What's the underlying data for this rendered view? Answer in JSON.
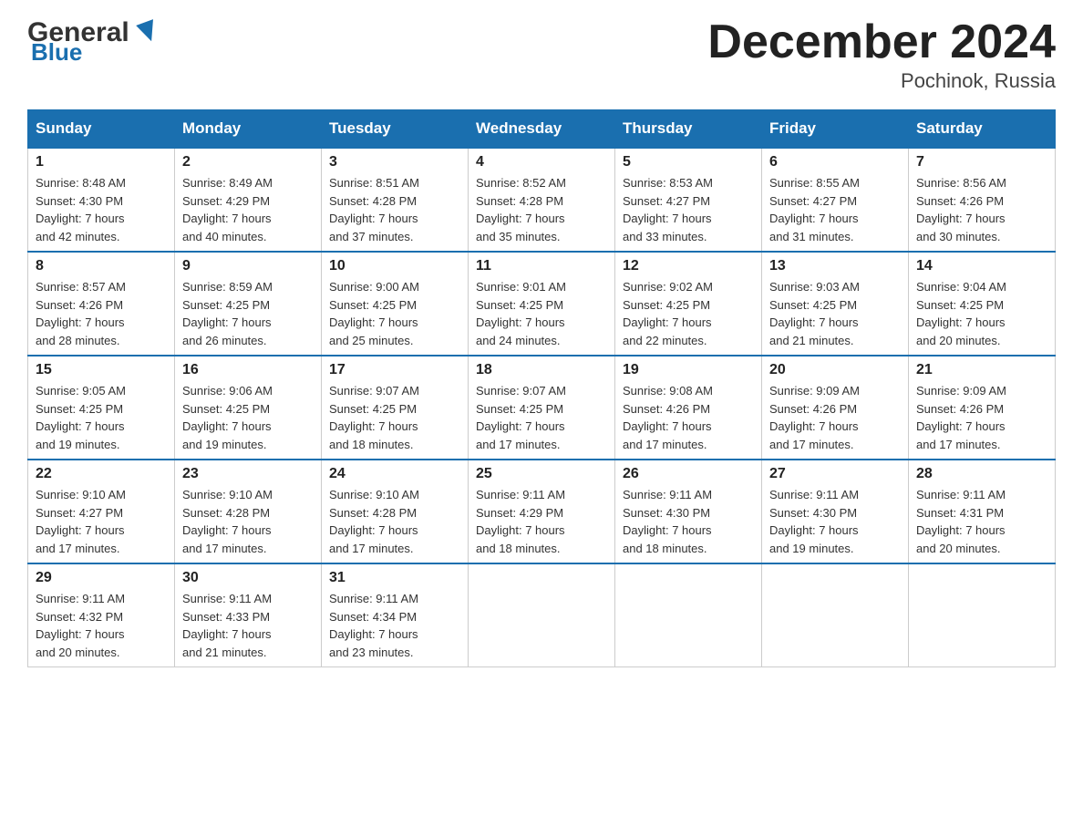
{
  "header": {
    "logo_general": "General",
    "logo_blue": "Blue",
    "title": "December 2024",
    "location": "Pochinok, Russia"
  },
  "days_of_week": [
    "Sunday",
    "Monday",
    "Tuesday",
    "Wednesday",
    "Thursday",
    "Friday",
    "Saturday"
  ],
  "weeks": [
    [
      {
        "day": "1",
        "sunrise": "Sunrise: 8:48 AM",
        "sunset": "Sunset: 4:30 PM",
        "daylight": "Daylight: 7 hours and 42 minutes."
      },
      {
        "day": "2",
        "sunrise": "Sunrise: 8:49 AM",
        "sunset": "Sunset: 4:29 PM",
        "daylight": "Daylight: 7 hours and 40 minutes."
      },
      {
        "day": "3",
        "sunrise": "Sunrise: 8:51 AM",
        "sunset": "Sunset: 4:28 PM",
        "daylight": "Daylight: 7 hours and 37 minutes."
      },
      {
        "day": "4",
        "sunrise": "Sunrise: 8:52 AM",
        "sunset": "Sunset: 4:28 PM",
        "daylight": "Daylight: 7 hours and 35 minutes."
      },
      {
        "day": "5",
        "sunrise": "Sunrise: 8:53 AM",
        "sunset": "Sunset: 4:27 PM",
        "daylight": "Daylight: 7 hours and 33 minutes."
      },
      {
        "day": "6",
        "sunrise": "Sunrise: 8:55 AM",
        "sunset": "Sunset: 4:27 PM",
        "daylight": "Daylight: 7 hours and 31 minutes."
      },
      {
        "day": "7",
        "sunrise": "Sunrise: 8:56 AM",
        "sunset": "Sunset: 4:26 PM",
        "daylight": "Daylight: 7 hours and 30 minutes."
      }
    ],
    [
      {
        "day": "8",
        "sunrise": "Sunrise: 8:57 AM",
        "sunset": "Sunset: 4:26 PM",
        "daylight": "Daylight: 7 hours and 28 minutes."
      },
      {
        "day": "9",
        "sunrise": "Sunrise: 8:59 AM",
        "sunset": "Sunset: 4:25 PM",
        "daylight": "Daylight: 7 hours and 26 minutes."
      },
      {
        "day": "10",
        "sunrise": "Sunrise: 9:00 AM",
        "sunset": "Sunset: 4:25 PM",
        "daylight": "Daylight: 7 hours and 25 minutes."
      },
      {
        "day": "11",
        "sunrise": "Sunrise: 9:01 AM",
        "sunset": "Sunset: 4:25 PM",
        "daylight": "Daylight: 7 hours and 24 minutes."
      },
      {
        "day": "12",
        "sunrise": "Sunrise: 9:02 AM",
        "sunset": "Sunset: 4:25 PM",
        "daylight": "Daylight: 7 hours and 22 minutes."
      },
      {
        "day": "13",
        "sunrise": "Sunrise: 9:03 AM",
        "sunset": "Sunset: 4:25 PM",
        "daylight": "Daylight: 7 hours and 21 minutes."
      },
      {
        "day": "14",
        "sunrise": "Sunrise: 9:04 AM",
        "sunset": "Sunset: 4:25 PM",
        "daylight": "Daylight: 7 hours and 20 minutes."
      }
    ],
    [
      {
        "day": "15",
        "sunrise": "Sunrise: 9:05 AM",
        "sunset": "Sunset: 4:25 PM",
        "daylight": "Daylight: 7 hours and 19 minutes."
      },
      {
        "day": "16",
        "sunrise": "Sunrise: 9:06 AM",
        "sunset": "Sunset: 4:25 PM",
        "daylight": "Daylight: 7 hours and 19 minutes."
      },
      {
        "day": "17",
        "sunrise": "Sunrise: 9:07 AM",
        "sunset": "Sunset: 4:25 PM",
        "daylight": "Daylight: 7 hours and 18 minutes."
      },
      {
        "day": "18",
        "sunrise": "Sunrise: 9:07 AM",
        "sunset": "Sunset: 4:25 PM",
        "daylight": "Daylight: 7 hours and 17 minutes."
      },
      {
        "day": "19",
        "sunrise": "Sunrise: 9:08 AM",
        "sunset": "Sunset: 4:26 PM",
        "daylight": "Daylight: 7 hours and 17 minutes."
      },
      {
        "day": "20",
        "sunrise": "Sunrise: 9:09 AM",
        "sunset": "Sunset: 4:26 PM",
        "daylight": "Daylight: 7 hours and 17 minutes."
      },
      {
        "day": "21",
        "sunrise": "Sunrise: 9:09 AM",
        "sunset": "Sunset: 4:26 PM",
        "daylight": "Daylight: 7 hours and 17 minutes."
      }
    ],
    [
      {
        "day": "22",
        "sunrise": "Sunrise: 9:10 AM",
        "sunset": "Sunset: 4:27 PM",
        "daylight": "Daylight: 7 hours and 17 minutes."
      },
      {
        "day": "23",
        "sunrise": "Sunrise: 9:10 AM",
        "sunset": "Sunset: 4:28 PM",
        "daylight": "Daylight: 7 hours and 17 minutes."
      },
      {
        "day": "24",
        "sunrise": "Sunrise: 9:10 AM",
        "sunset": "Sunset: 4:28 PM",
        "daylight": "Daylight: 7 hours and 17 minutes."
      },
      {
        "day": "25",
        "sunrise": "Sunrise: 9:11 AM",
        "sunset": "Sunset: 4:29 PM",
        "daylight": "Daylight: 7 hours and 18 minutes."
      },
      {
        "day": "26",
        "sunrise": "Sunrise: 9:11 AM",
        "sunset": "Sunset: 4:30 PM",
        "daylight": "Daylight: 7 hours and 18 minutes."
      },
      {
        "day": "27",
        "sunrise": "Sunrise: 9:11 AM",
        "sunset": "Sunset: 4:30 PM",
        "daylight": "Daylight: 7 hours and 19 minutes."
      },
      {
        "day": "28",
        "sunrise": "Sunrise: 9:11 AM",
        "sunset": "Sunset: 4:31 PM",
        "daylight": "Daylight: 7 hours and 20 minutes."
      }
    ],
    [
      {
        "day": "29",
        "sunrise": "Sunrise: 9:11 AM",
        "sunset": "Sunset: 4:32 PM",
        "daylight": "Daylight: 7 hours and 20 minutes."
      },
      {
        "day": "30",
        "sunrise": "Sunrise: 9:11 AM",
        "sunset": "Sunset: 4:33 PM",
        "daylight": "Daylight: 7 hours and 21 minutes."
      },
      {
        "day": "31",
        "sunrise": "Sunrise: 9:11 AM",
        "sunset": "Sunset: 4:34 PM",
        "daylight": "Daylight: 7 hours and 23 minutes."
      },
      null,
      null,
      null,
      null
    ]
  ]
}
